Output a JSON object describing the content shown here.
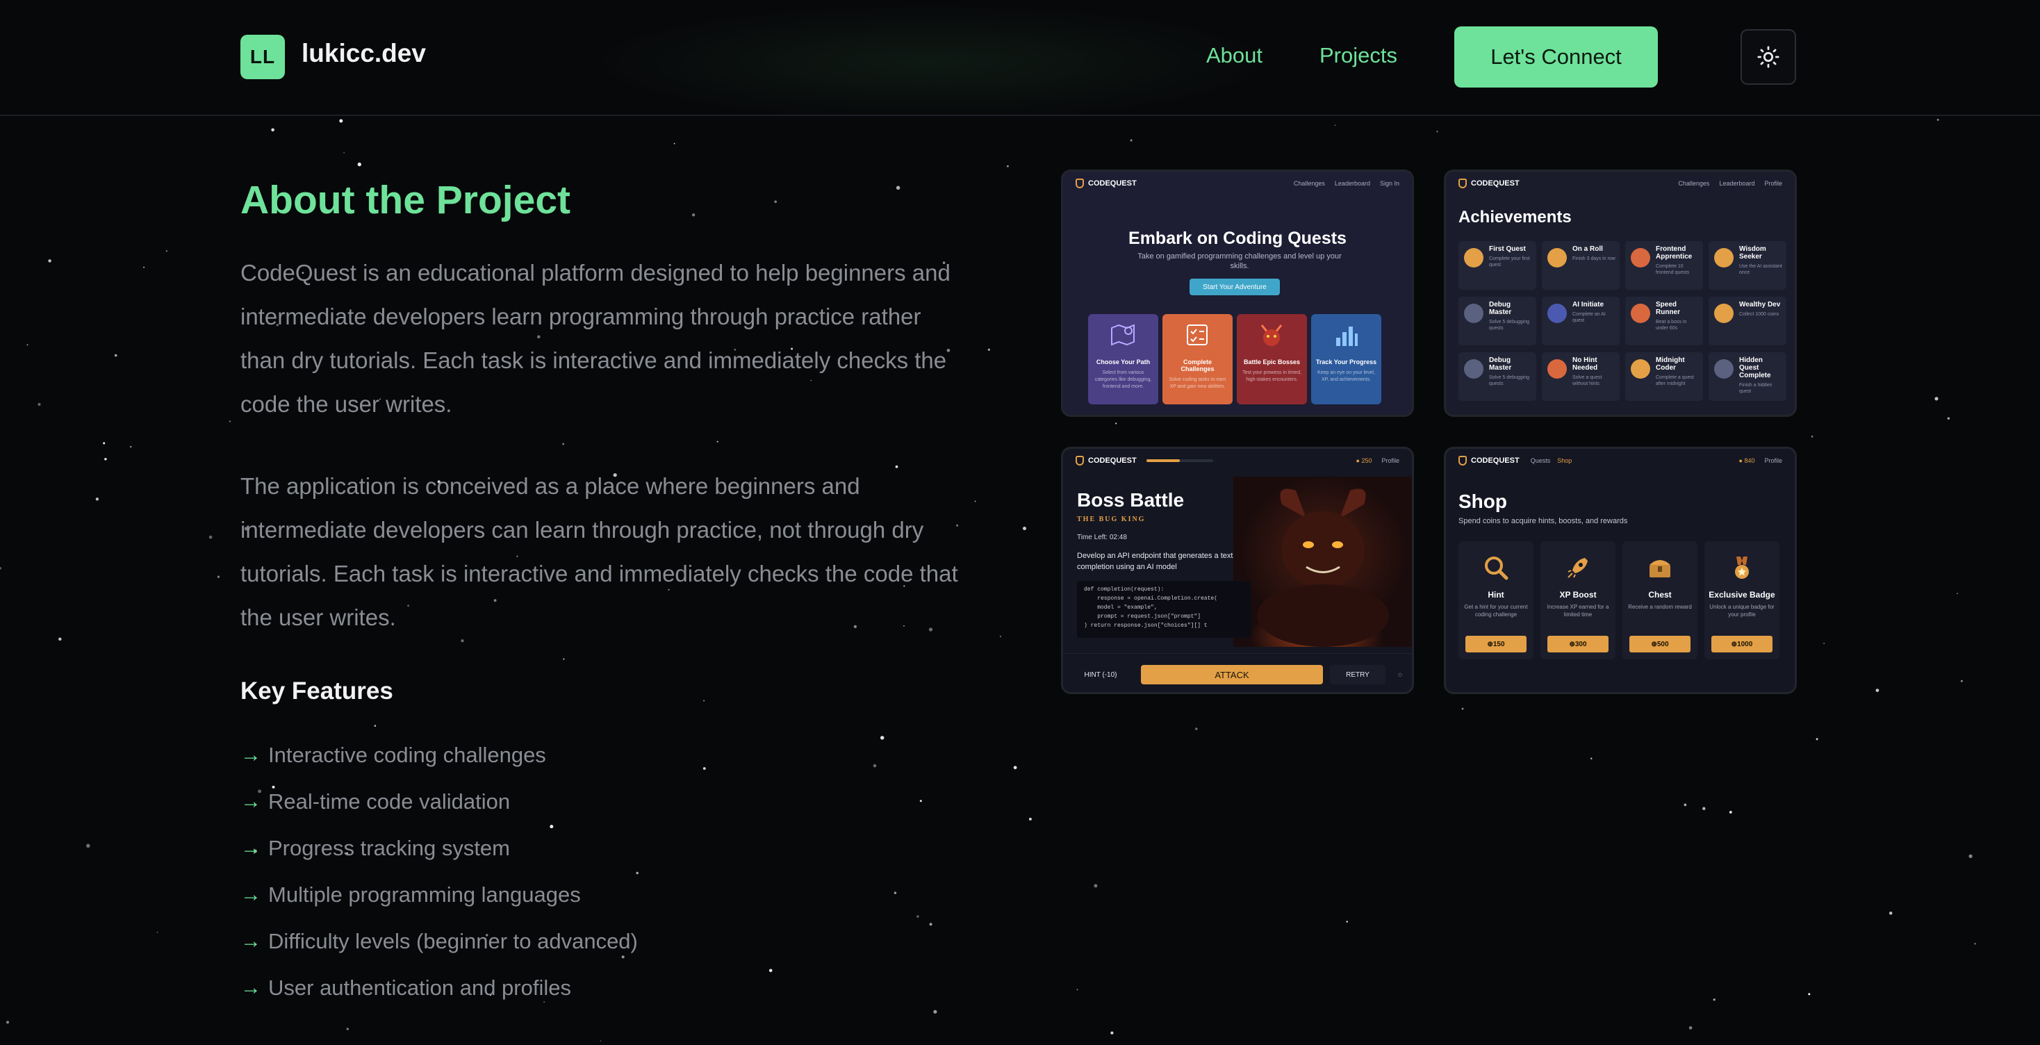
{
  "header": {
    "logo_initials": "LL",
    "site_name": "lukicc.dev",
    "nav": [
      "About",
      "Projects"
    ],
    "cta_label": "Let's Connect",
    "theme_icon": "sun-icon"
  },
  "main": {
    "title": "About the Project",
    "paragraphs": [
      "CodeQuest is an educational platform designed to help beginners and intermediate developers learn programming through practice rather than dry tutorials. Each task is interactive and immediately checks the code the user writes.",
      "The application is conceived as a place where beginners and intermediate developers can learn through practice, not through dry tutorials. Each task is interactive and immediately checks the code that the user writes."
    ],
    "features_title": "Key Features",
    "features": [
      "Interactive coding challenges",
      "Real-time code validation",
      "Progress tracking system",
      "Multiple programming languages",
      "Difficulty levels (beginner to advanced)",
      "User authentication and profiles"
    ]
  },
  "screens": {
    "home": {
      "brand": "CODEQUEST",
      "links": [
        "Challenges",
        "Leaderboard",
        "Sign In"
      ],
      "title": "Embark on Coding Quests",
      "subtitle": "Take on gamified programming challenges and level up your skills.",
      "button": "Start Your Adventure",
      "cards": [
        {
          "title": "Choose Your Path",
          "desc": "Select from various categories like debugging, frontend and more.",
          "color": "#4b3f86"
        },
        {
          "title": "Complete Challenges",
          "desc": "Solve coding tasks to earn XP and gain new abilities.",
          "color": "#d9683e"
        },
        {
          "title": "Battle Epic Bosses",
          "desc": "Test your prowess in timed, high-stakes encounters.",
          "color": "#8e2a2f"
        },
        {
          "title": "Track Your Progress",
          "desc": "Keep an eye on your level, XP, and achievements.",
          "color": "#2c5a9c"
        }
      ]
    },
    "achievements": {
      "brand": "CODEQUEST",
      "links": [
        "Challenges",
        "Leaderboard",
        "Profile"
      ],
      "title": "Achievements",
      "items": [
        {
          "name": "First Quest",
          "desc": "Complete your first quest",
          "color": "#e3a046"
        },
        {
          "name": "On a Roll",
          "desc": "Finish 3 days in row",
          "color": "#e3a046"
        },
        {
          "name": "Frontend Apprentice",
          "desc": "Complete 10 frontend quests",
          "color": "#d9683e"
        },
        {
          "name": "Wisdom Seeker",
          "desc": "Use the AI assistant once",
          "color": "#e3a046"
        },
        {
          "name": "Debug Master",
          "desc": "Solve 5 debugging quests",
          "color": "#5a6280"
        },
        {
          "name": "AI Initiate",
          "desc": "Complete an AI quest",
          "color": "#4b5ab0"
        },
        {
          "name": "Speed Runner",
          "desc": "Beat a boss in under 60s",
          "color": "#d9683e"
        },
        {
          "name": "Wealthy Dev",
          "desc": "Collect 1000 coins",
          "color": "#e3a046"
        },
        {
          "name": "Debug Master",
          "desc": "Solve 5 debugging quests",
          "color": "#5a6280"
        },
        {
          "name": "No Hint Needed",
          "desc": "Solve a quest without hints",
          "color": "#d9683e"
        },
        {
          "name": "Midnight Coder",
          "desc": "Complete a quest after midnight",
          "color": "#e3a046"
        },
        {
          "name": "Hidden Quest Complete",
          "desc": "Finish a hidden quest",
          "color": "#5a6280"
        }
      ]
    },
    "boss": {
      "brand": "CODEQUEST",
      "coins": "250",
      "profile": "Profile",
      "title": "Boss Battle",
      "subtitle": "THE BUG KING",
      "timer": "Time Left: 02:48",
      "task": "Develop an API endpoint that generates a text completion using an AI model",
      "code": "def completion(request):\n    response = openai.Completion.create(\n    model = \"example\",\n    prompt = request.json[\"prompt\"]\n) return response.json[\"choices\"][] t",
      "hint": "HINT (-10)",
      "attack": "ATTACK",
      "retry": "RETRY",
      "progress": 0.5
    },
    "shop": {
      "brand": "CODEQUEST",
      "links": [
        "Quests",
        "Shop"
      ],
      "coins": "840",
      "profile": "Profile",
      "title": "Shop",
      "subtitle": "Spend coins to acquire hints, boosts, and rewards",
      "items": [
        {
          "name": "Hint",
          "desc": "Get a hint for your current coding challenge",
          "price": "150",
          "icon": "magnifier-icon"
        },
        {
          "name": "XP Boost",
          "desc": "Increase XP earned for a limited time",
          "price": "300",
          "icon": "rocket-icon"
        },
        {
          "name": "Chest",
          "desc": "Receive a random reward",
          "price": "500",
          "icon": "chest-icon"
        },
        {
          "name": "Exclusive Badge",
          "desc": "Unlock a unique badge for your profile",
          "price": "1000",
          "icon": "badge-icon"
        }
      ]
    }
  },
  "colors": {
    "accent": "#6ee29a",
    "background": "#07080a",
    "orange": "#e3a046"
  }
}
